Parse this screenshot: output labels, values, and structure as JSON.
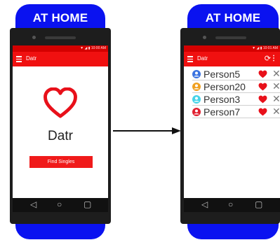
{
  "left_phone": {
    "case_title": "AT HOME",
    "status_time": "10:00 AM",
    "app_title": "Datr",
    "logo_text": "Datr",
    "find_button_label": "Find Singles"
  },
  "right_phone": {
    "case_title": "AT HOME",
    "status_time": "10:01 AM",
    "app_title": "Datr",
    "people": [
      {
        "name": "Person5",
        "avatar_color": "#3b73e0"
      },
      {
        "name": "Person20",
        "avatar_color": "#f0a020"
      },
      {
        "name": "Person3",
        "avatar_color": "#46d3e8"
      },
      {
        "name": "Person7",
        "avatar_color": "#e02030"
      }
    ]
  },
  "icons": {
    "menu": "hamburger-menu-icon",
    "refresh": "refresh-icon",
    "more": "more-vert-icon",
    "back": "back-triangle-icon",
    "home": "home-circle-icon",
    "recents": "recents-square-icon",
    "heart": "heart-icon",
    "close": "close-x-icon",
    "avatar": "person-avatar-icon"
  },
  "colors": {
    "case_blue": "#0a12f0",
    "appbar_red": "#f01010",
    "heart_red": "#e8101a"
  }
}
